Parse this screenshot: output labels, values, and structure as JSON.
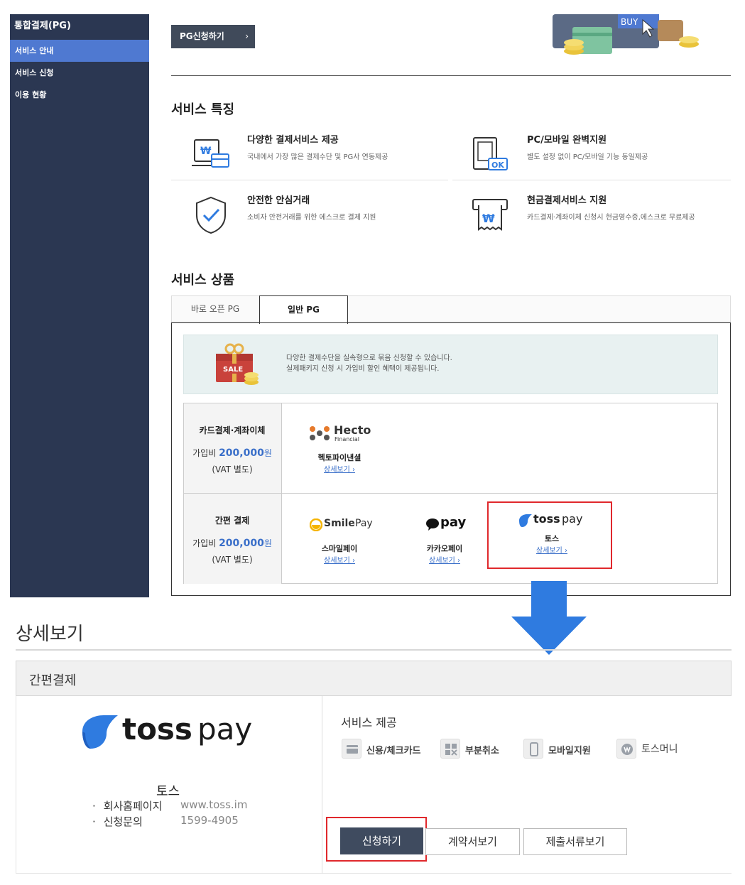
{
  "sidebar": {
    "title": "통합결제(PG)",
    "items": [
      {
        "label": "서비스 안내"
      },
      {
        "label": "서비스 신청"
      },
      {
        "label": "이용 현황"
      }
    ]
  },
  "top": {
    "apply_button": "PG신청하기",
    "chevron": "›",
    "banner_buy": "BUY"
  },
  "features": {
    "title": "서비스 특징",
    "items": [
      {
        "title": "다양한 결제서비스 제공",
        "desc": "국내에서 가장 많은 결제수단 및 PG사 연동제공",
        "icon": "card-won-icon"
      },
      {
        "title": "PC/모바일 완벽지원",
        "desc": "별도 설정 없이 PC/모바일 기능 동일제공",
        "icon": "mobile-ok-icon",
        "icon_text": "OK"
      },
      {
        "title": "안전한 안심거래",
        "desc": "소비자 안전거래를 위한 에스크로 결제 지원",
        "icon": "shield-check-icon"
      },
      {
        "title": "현금결제서비스 지원",
        "desc": "카드결제·계좌이체 신청시 현금영수증,에스크로 무료제공",
        "icon": "receipt-won-icon"
      }
    ]
  },
  "products": {
    "title": "서비스 상품",
    "tabs": [
      {
        "label": "바로 오픈 PG",
        "active": false
      },
      {
        "label": "일반 PG",
        "active": true
      }
    ],
    "info": {
      "badge": "SALE",
      "line1": "다양한 결제수단을 실속형으로 묶음 신청할 수 있습니다.",
      "line2": "실제패키지 신청 시 가입비 할인 혜택이 제공됩니다."
    },
    "rows": [
      {
        "category": "카드결제·계좌이체",
        "fee_label": "가입비",
        "fee_amount": "200,000",
        "fee_unit": "원",
        "vat": "(VAT 별도)",
        "providers": [
          {
            "logo": "Hecto",
            "logo_sub": "Financial",
            "name": "헥토파이낸셜",
            "link": "상세보기 ›"
          }
        ]
      },
      {
        "category": "간편 결제",
        "fee_label": "가입비",
        "fee_amount": "200,000",
        "fee_unit": "원",
        "vat": "(VAT 별도)",
        "providers": [
          {
            "logo_a": "Smile",
            "logo_b": "Pay",
            "name": "스마일페이",
            "link": "상세보기 ›"
          },
          {
            "logo": "pay",
            "name": "카카오페이",
            "link": "상세보기 ›"
          },
          {
            "logo_a": "toss",
            "logo_b": "pay",
            "name": "토스",
            "link": "상세보기 ›"
          }
        ]
      }
    ]
  },
  "detail": {
    "title": "상세보기",
    "header": "간편결제",
    "logo_a": "toss",
    "logo_b": "pay",
    "company": "토스",
    "info": [
      {
        "label": "회사홈페이지",
        "value": "www.toss.im"
      },
      {
        "label": "신청문의",
        "value": "1599-4905"
      }
    ],
    "bullet": "·",
    "services_title": "서비스 제공",
    "services": [
      {
        "label": "신용/체크카드",
        "icon": "credit-card-icon"
      },
      {
        "label": "부분취소",
        "icon": "partial-cancel-icon"
      },
      {
        "label": "모바일지원",
        "icon": "mobile-icon"
      },
      {
        "label": "토스머니",
        "icon": "toss-money-icon"
      }
    ],
    "buttons": {
      "apply": "신청하기",
      "contract": "계약서보기",
      "documents": "제출서류보기"
    }
  },
  "colors": {
    "sidebar_bg": "#2b3752",
    "sidebar_active": "#4f79d1",
    "accent_blue": "#3a6fc9",
    "highlight_red": "#e0282c",
    "arrow_blue": "#2f7be0"
  }
}
